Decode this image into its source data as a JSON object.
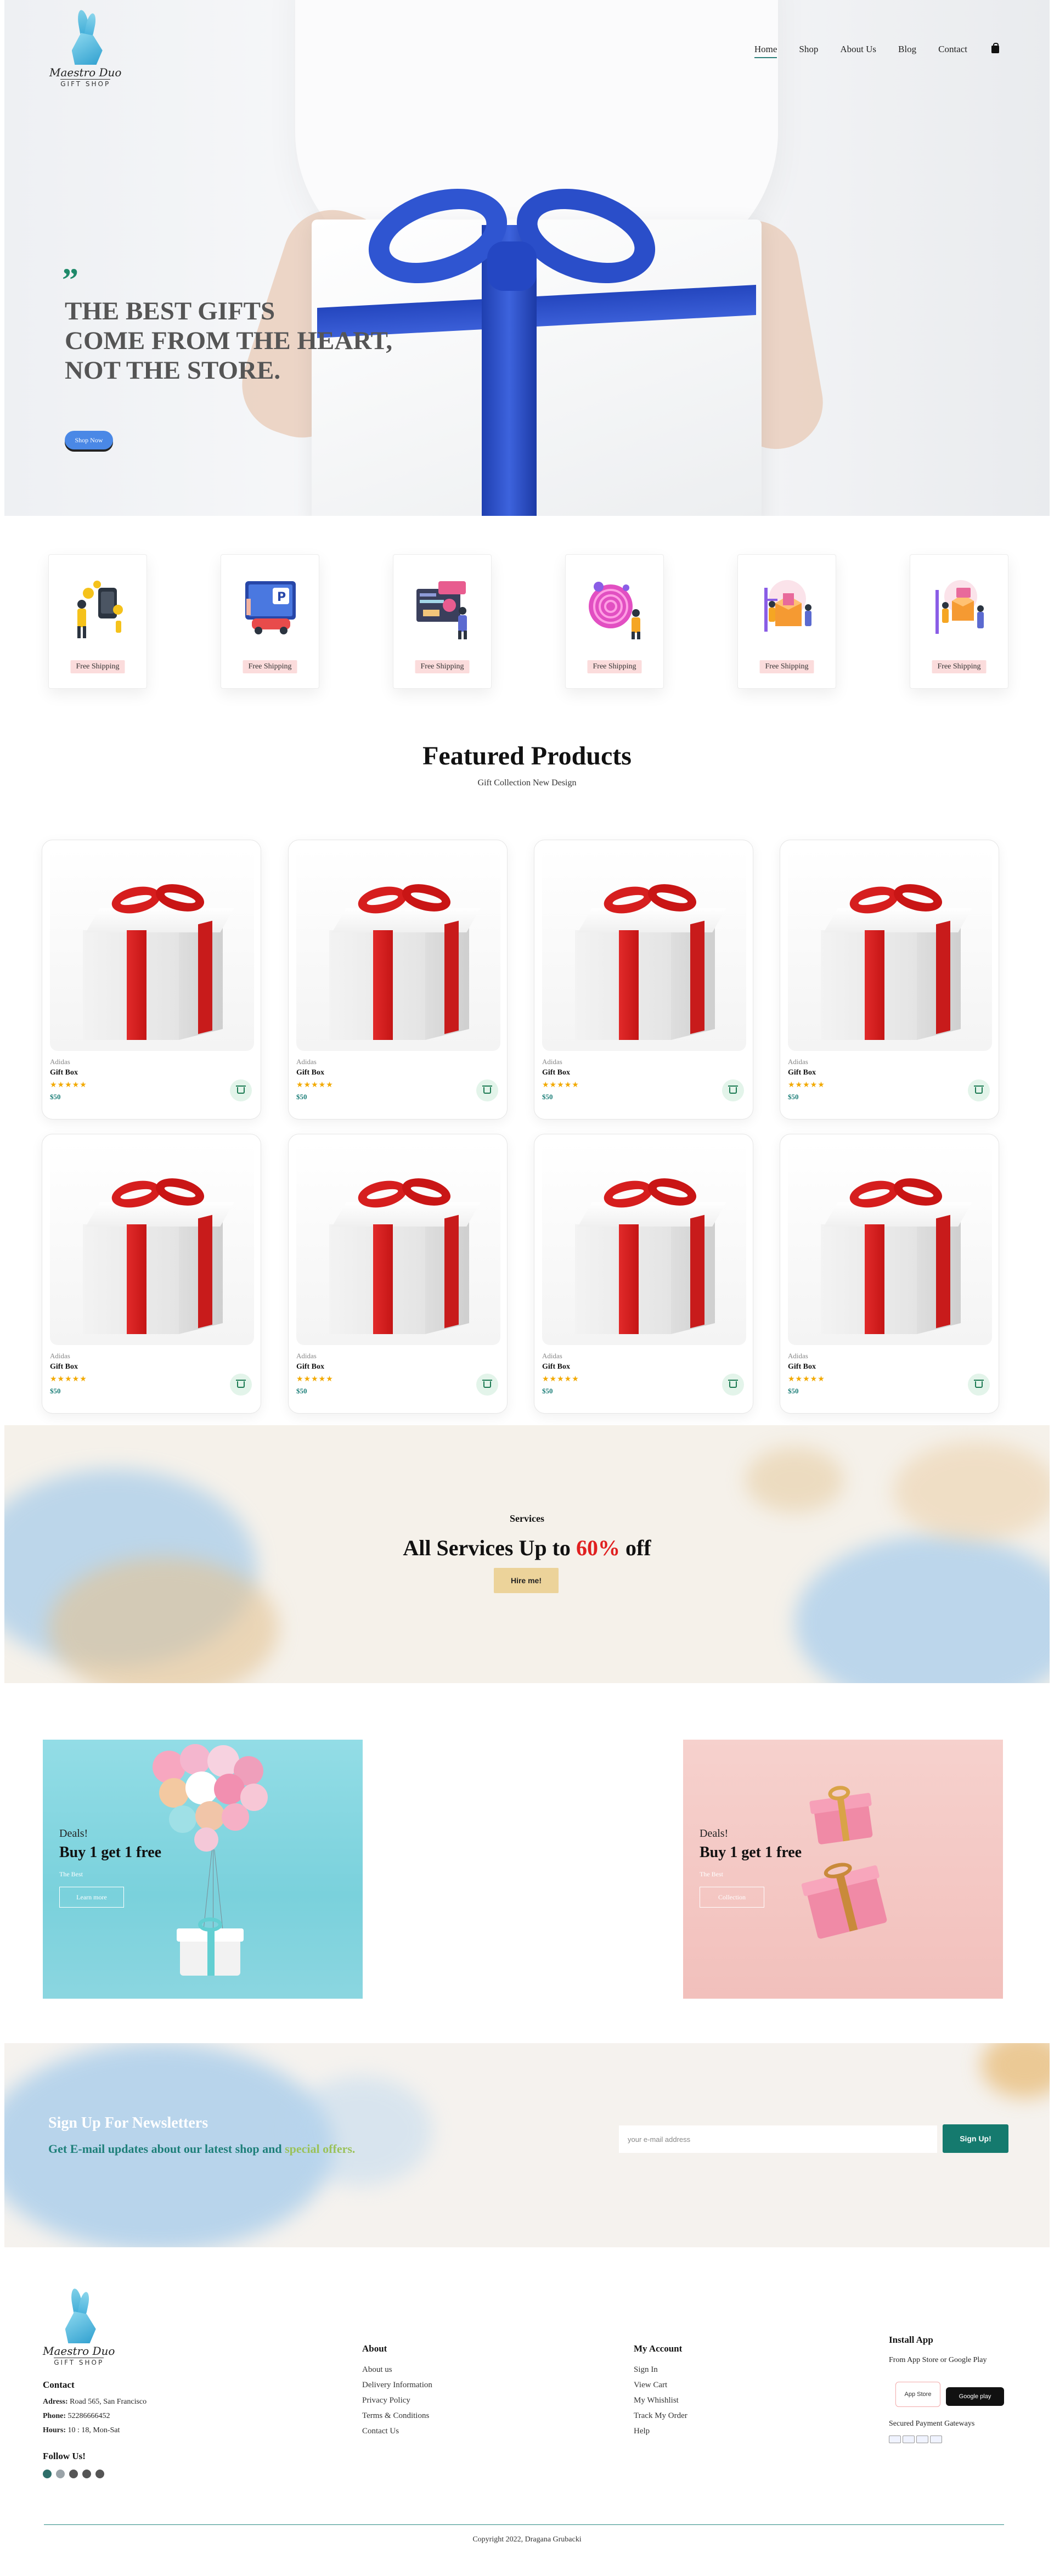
{
  "brand": {
    "script": "Maestro Duo",
    "sub": "GIFT SHOP"
  },
  "nav": {
    "items": [
      "Home",
      "Shop",
      "About Us",
      "Blog",
      "Contact"
    ],
    "cart_icon": "shopping-bag-icon"
  },
  "hero": {
    "quote_mark": "”",
    "title_lines": [
      "THE BEST GIFTS",
      "COME FROM THE HEART,",
      "NOT THE STORE."
    ],
    "button": "Shop Now"
  },
  "features": [
    {
      "label": "Free Shipping",
      "icon": "payment-illustration-icon"
    },
    {
      "label": "Free Shipping",
      "icon": "parking-illustration-icon"
    },
    {
      "label": "Free Shipping",
      "icon": "dashboard-illustration-icon"
    },
    {
      "label": "Free Shipping",
      "icon": "fingerprint-illustration-icon"
    },
    {
      "label": "Free Shipping",
      "icon": "delivery-box-illustration-icon"
    },
    {
      "label": "Free Shipping",
      "icon": "package-illustration-icon"
    }
  ],
  "featured": {
    "title": "Featured Products",
    "subtitle": "Gift Collection New Design",
    "products": [
      {
        "brand": "Adidas",
        "name": "Gift Box",
        "stars": "★★★★★",
        "price": "$50"
      },
      {
        "brand": "Adidas",
        "name": "Gift Box",
        "stars": "★★★★★",
        "price": "$50"
      },
      {
        "brand": "Adidas",
        "name": "Gift Box",
        "stars": "★★★★★",
        "price": "$50"
      },
      {
        "brand": "Adidas",
        "name": "Gift Box",
        "stars": "★★★★★",
        "price": "$50"
      },
      {
        "brand": "Adidas",
        "name": "Gift Box",
        "stars": "★★★★★",
        "price": "$50"
      },
      {
        "brand": "Adidas",
        "name": "Gift Box",
        "stars": "★★★★★",
        "price": "$50"
      },
      {
        "brand": "Adidas",
        "name": "Gift Box",
        "stars": "★★★★★",
        "price": "$50"
      },
      {
        "brand": "Adidas",
        "name": "Gift Box",
        "stars": "★★★★★",
        "price": "$50"
      }
    ]
  },
  "services": {
    "label": "Services",
    "title_prefix": "All Services Up to ",
    "title_highlight": "60%",
    "title_suffix": " off",
    "button": "Hire me!"
  },
  "deals": [
    {
      "label": "Deals!",
      "title": "Buy 1 get 1 free",
      "sub": "The Best",
      "button": "Learn more"
    },
    {
      "label": "Deals!",
      "title": "Buy 1 get 1 free",
      "sub": "The Best",
      "button": "Collection"
    }
  ],
  "newsletter": {
    "title": "Sign Up For Newsletters",
    "sub_prefix": "Get E-mail updates about our latest shop and ",
    "sub_highlight": "special offers.",
    "placeholder": "your e-mail address",
    "button": "Sign Up!"
  },
  "footer": {
    "contact": {
      "heading": "Contact",
      "address_label": "Adress:",
      "address": " Road 565, San Francisco",
      "phone_label": "Phone:",
      "phone": " 52286666452",
      "hours_label": "Hours:",
      "hours": " 10 : 18, Mon-Sat",
      "follow": "Follow Us!"
    },
    "about": {
      "heading": "About",
      "links": [
        "About us",
        "Delivery Information",
        "Privacy Policy",
        "Terms & Conditions",
        "Contact Us"
      ]
    },
    "account": {
      "heading": "My Account",
      "links": [
        "Sign In",
        "View Cart",
        "My Whishlist",
        "Track My Order",
        "Help"
      ]
    },
    "app": {
      "heading": "Install App",
      "text": "From App Store or Google Play",
      "badge_apple": "App Store",
      "badge_google": "Google play",
      "payment": "Secured Payment Gateways"
    },
    "copyright": "Copyright 2022, Dragana Grubacki"
  }
}
